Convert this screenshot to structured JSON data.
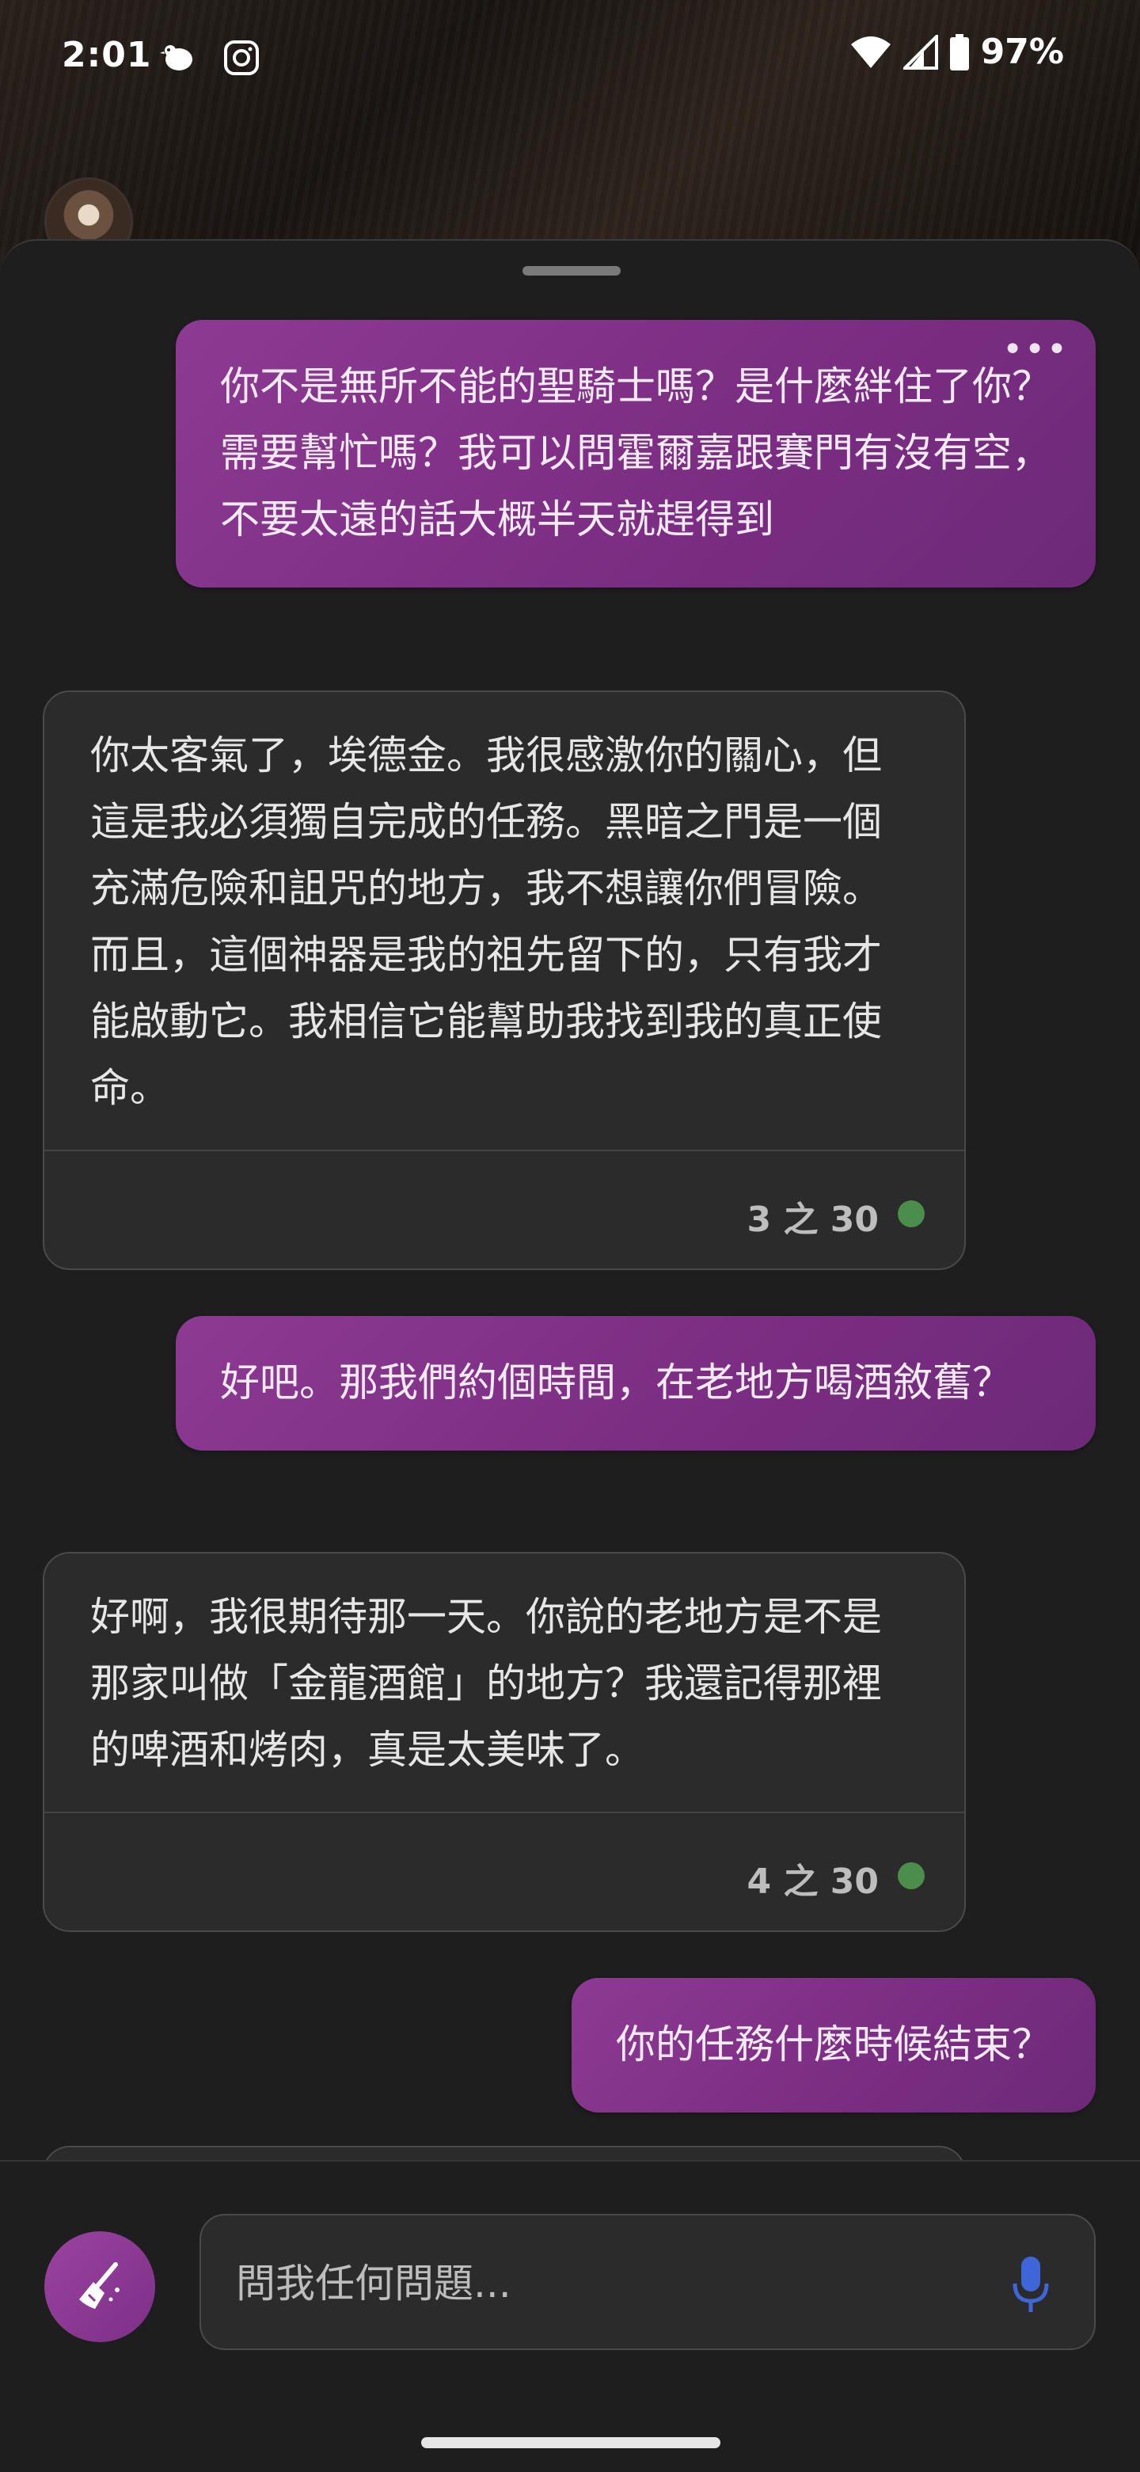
{
  "status_bar": {
    "time": "2:01",
    "battery": "97%",
    "icons": [
      "bird-icon",
      "instagram-icon",
      "wifi-icon",
      "signal-icon",
      "battery-icon"
    ]
  },
  "conversation": {
    "messages": [
      {
        "role": "user",
        "text": "你不是無所不能的聖騎士嗎？是什麼絆住了你？需要幫忙嗎？我可以問霍爾嘉跟賽門有沒有空，不要太遠的話大概半天就趕得到"
      },
      {
        "role": "assistant",
        "text": "你太客氣了，埃德金。我很感激你的關心，但這是我必須獨自完成的任務。黑暗之門是一個充滿危險和詛咒的地方，我不想讓你們冒險。而且，這個神器是我的祖先留下的，只有我才能啟動它。我相信它能幫助我找到我的真正使命。",
        "counter": "3 之 30"
      },
      {
        "role": "user",
        "text": "好吧。那我們約個時間，在老地方喝酒敘舊？"
      },
      {
        "role": "assistant",
        "text": "好啊，我很期待那一天。你說的老地方是不是那家叫做「金龍酒館」的地方？我還記得那裡的啤酒和烤肉，真是太美味了。",
        "counter": "4 之 30"
      },
      {
        "role": "user",
        "text": "你的任務什麼時候結束？"
      }
    ],
    "more_menu": "•••"
  },
  "input": {
    "placeholder": "問我任何問題..."
  },
  "colors": {
    "user_bubble": "#7a2d82",
    "bot_bubble": "#2b2b2b",
    "status_dot": "#4b8e4b",
    "mic": "#3f66d8"
  }
}
